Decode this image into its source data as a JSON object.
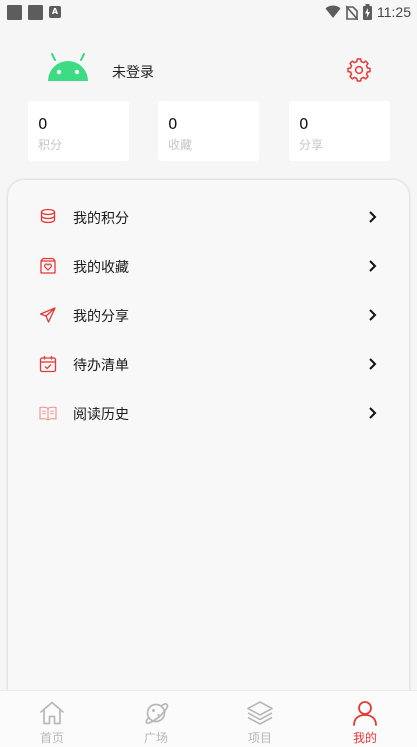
{
  "status_bar": {
    "time": "11:25",
    "notification_glyph": "A"
  },
  "profile": {
    "login_text": "未登录",
    "avatar_icon": "android-icon",
    "settings_icon": "gear-icon"
  },
  "stats": [
    {
      "value": "0",
      "label": "积分"
    },
    {
      "value": "0",
      "label": "收藏"
    },
    {
      "value": "0",
      "label": "分享"
    }
  ],
  "menu": [
    {
      "label": "我的积分",
      "icon": "coins-stack-icon"
    },
    {
      "label": "我的收藏",
      "icon": "favorite-box-icon"
    },
    {
      "label": "我的分享",
      "icon": "paper-plane-icon"
    },
    {
      "label": "待办清单",
      "icon": "calendar-check-icon"
    },
    {
      "label": "阅读历史",
      "icon": "open-book-icon"
    }
  ],
  "bottom_nav": [
    {
      "label": "首页",
      "icon": "home-icon",
      "active": false
    },
    {
      "label": "广场",
      "icon": "planet-icon",
      "active": false
    },
    {
      "label": "项目",
      "icon": "layers-icon",
      "active": false
    },
    {
      "label": "我的",
      "icon": "person-icon",
      "active": true
    }
  ],
  "colors": {
    "accent": "#e53935",
    "android_green": "#3ddc84",
    "inactive": "#b8b8b8",
    "background": "#f6f6f6"
  }
}
